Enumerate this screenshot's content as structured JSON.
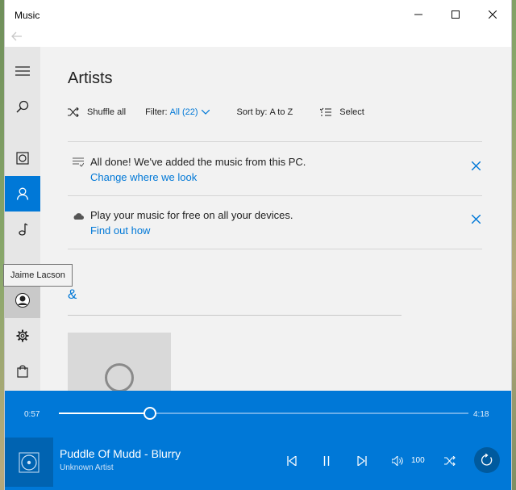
{
  "window": {
    "app_title": "Music",
    "controls": [
      "minimize-icon",
      "maximize-icon",
      "close-icon"
    ]
  },
  "navigation": {
    "back_icon": "back-arrow-icon"
  },
  "sidebar": {
    "items": [
      {
        "name": "hamburger-menu",
        "icon": "hamburger-icon"
      },
      {
        "name": "search",
        "icon": "search-icon"
      },
      {
        "name": "my-music",
        "icon": "album-icon"
      },
      {
        "name": "artists",
        "icon": "person-icon",
        "active": true
      },
      {
        "name": "songs",
        "icon": "music-note-icon"
      },
      {
        "name": "account",
        "icon": "account-avatar-icon",
        "hover": true
      },
      {
        "name": "settings",
        "icon": "gear-icon"
      },
      {
        "name": "store",
        "icon": "shopping-bag-icon"
      }
    ],
    "tooltip": "Jaime Lacson"
  },
  "main": {
    "title": "Artists",
    "toolbar": {
      "shuffle_label": "Shuffle all",
      "filter_label": "Filter:",
      "filter_value": "All (22)",
      "sort_label": "Sort by:",
      "sort_value": "A to Z",
      "select_label": "Select"
    },
    "notices": [
      {
        "icon": "list-check-icon",
        "text": "All done! We've added the music from this PC.",
        "link": "Change where we look"
      },
      {
        "icon": "cloud-icon",
        "text": "Play your music for free on all your devices.",
        "link": "Find out how"
      }
    ],
    "section_letter": "&"
  },
  "player": {
    "elapsed": "0:57",
    "duration": "4:18",
    "progress_fraction": 0.221,
    "song_title": "Puddle Of Mudd - Blurry",
    "artist": "Unknown Artist",
    "volume": "100",
    "accent_color": "#0078d7"
  }
}
